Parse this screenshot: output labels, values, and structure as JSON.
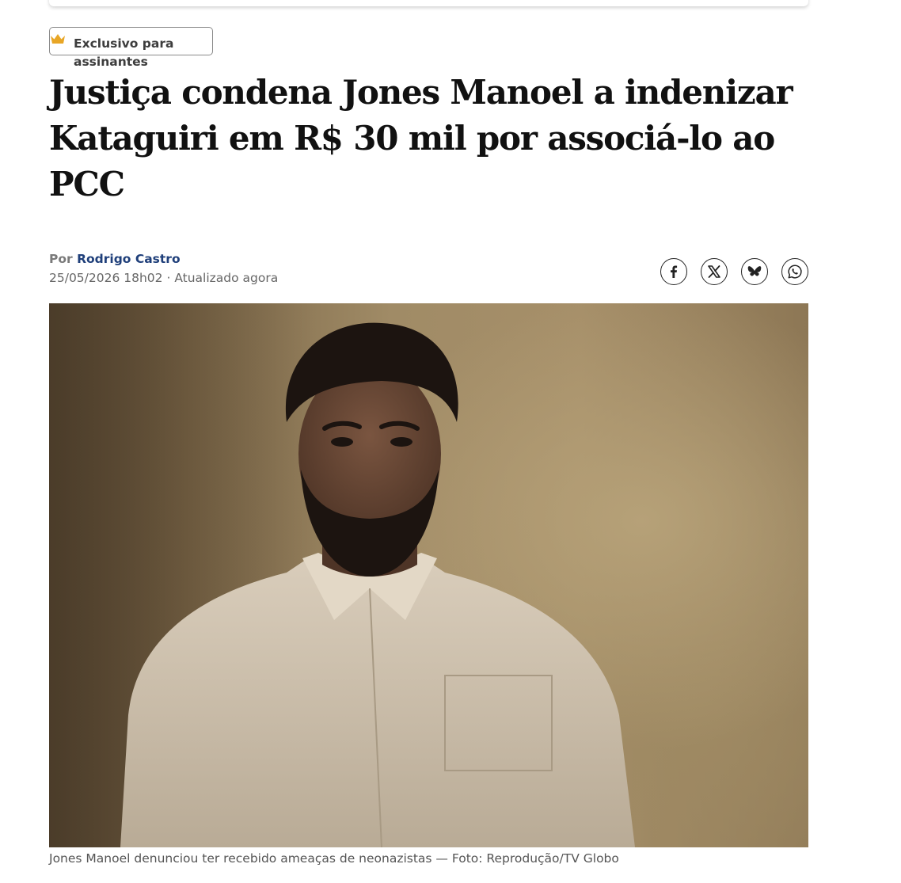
{
  "badge": {
    "line1": "Exclusivo para",
    "line2": "assinantes",
    "icon": "crown-icon",
    "icon_color": "#e8a626"
  },
  "article": {
    "headline": "Justiça condena Jones Manoel a indenizar Kataguiri em R$ 30 mil por associá-lo ao PCC",
    "byline_prefix": "Por",
    "author": "Rodrigo Castro",
    "date": "25/05/2026 18h02 · Atualizado agora",
    "caption": "Jones Manoel denunciou ter recebido ameaças de neonazistas — Foto: Reprodução/TV Globo"
  },
  "share": [
    {
      "name": "facebook",
      "icon": "facebook-icon"
    },
    {
      "name": "x",
      "icon": "x-icon"
    },
    {
      "name": "bluesky",
      "icon": "bluesky-icon"
    },
    {
      "name": "whatsapp",
      "icon": "whatsapp-icon"
    }
  ],
  "colors": {
    "author_link": "#1f3f7a",
    "meta_text": "#666666",
    "headline": "#111111"
  }
}
